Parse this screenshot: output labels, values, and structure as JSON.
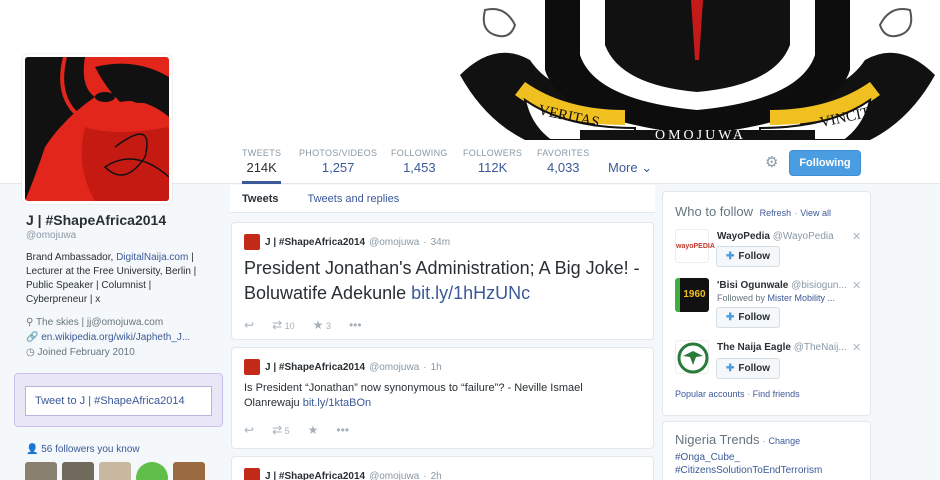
{
  "banner": {
    "veritas": "VERITAS",
    "vincit": "VINCIT",
    "name": "OMOJUWA"
  },
  "nav": {
    "stats": [
      {
        "label": "TWEETS",
        "value": "214K"
      },
      {
        "label": "PHOTOS/VIDEOS",
        "value": "1,257"
      },
      {
        "label": "FOLLOWING",
        "value": "1,453"
      },
      {
        "label": "FOLLOWERS",
        "value": "112K"
      },
      {
        "label": "FAVORITES",
        "value": "4,033"
      }
    ],
    "more_label": "More",
    "follow_button": "Following"
  },
  "profile": {
    "name": "J | #ShapeAfrica2014",
    "handle": "@omojuwa",
    "bio_prefix": "Brand Ambassador, ",
    "bio_link": "DigitalNaija.com",
    "bio_rest": " | Lecturer at the Free University, Berlin | Public Speaker | Columnist | Cyberpreneur | x",
    "location": "The skies | jj@omojuwa.com",
    "website": "en.wikipedia.org/wiki/Japheth_J...",
    "joined": "Joined February 2010",
    "tweet_to": "Tweet to J | #ShapeAfrica2014",
    "followers_you_know": "56 followers you know"
  },
  "timeline": {
    "tabs": [
      "Tweets",
      "Tweets and replies"
    ],
    "tweets": [
      {
        "name": "J | #ShapeAfrica2014",
        "handle": "@omojuwa",
        "time": "34m",
        "text": "President Jonathan's Administration; A Big Joke! - Boluwatife Adekunle ",
        "link": "bit.ly/1hHzUNc",
        "retweets": "10",
        "favorites": "3"
      },
      {
        "name": "J | #ShapeAfrica2014",
        "handle": "@omojuwa",
        "time": "1h",
        "text": "Is President “Jonathan” now synonymous to “failure”? - Neville Ismael Olanrewaju ",
        "link": "bit.ly/1ktaBOn",
        "retweets": "5",
        "favorites": ""
      },
      {
        "name": "J | #ShapeAfrica2014",
        "handle": "@omojuwa",
        "time": "2h"
      }
    ]
  },
  "who_to_follow": {
    "title": "Who to follow",
    "refresh": "Refresh",
    "view_all": "View all",
    "items": [
      {
        "name": "WayoPedia",
        "handle": "@WayoPedia",
        "sub": "",
        "avatar_text": "wayoPEDIA",
        "follow": "Follow"
      },
      {
        "name": "'Bisi Ogunwale",
        "handle": "@bisiogun...",
        "sub_prefix": "Followed by ",
        "sub_link": "Mister Mobility ...",
        "avatar_text": "1960",
        "follow": "Follow"
      },
      {
        "name": "The Naija Eagle",
        "handle": "@TheNaij...",
        "sub": "",
        "avatar_text": "",
        "follow": "Follow"
      }
    ],
    "popular": "Popular accounts",
    "find_friends": "Find friends"
  },
  "trends": {
    "title": "Nigeria Trends",
    "change": "Change",
    "items": [
      "#Onga_Cube_",
      "#CitizensSolutionToEndTerrorism"
    ]
  }
}
